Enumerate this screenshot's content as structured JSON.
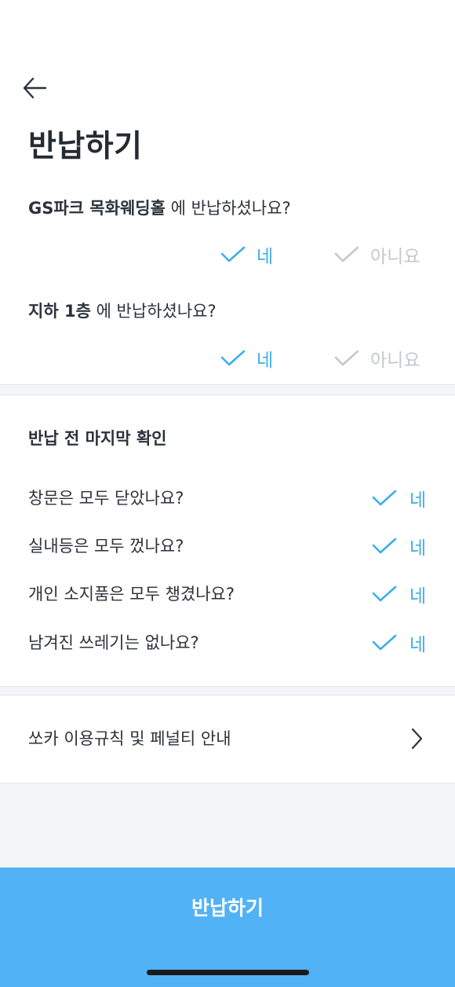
{
  "header": {
    "back_icon": "arrow-left-icon",
    "title": "반납하기"
  },
  "questions": [
    {
      "subject": "GS파크 목화웨딩홀",
      "suffix": " 에 반납하셨나요?",
      "yes_label": "네",
      "no_label": "아니요",
      "selected": "yes"
    },
    {
      "subject": "지하 1층",
      "suffix": " 에 반납하셨나요?",
      "yes_label": "네",
      "no_label": "아니요",
      "selected": "yes"
    }
  ],
  "checklist": {
    "title": "반납 전 마지막 확인",
    "items": [
      {
        "label": "창문은 모두 닫았나요?",
        "yes_label": "네"
      },
      {
        "label": "실내등은 모두 껐나요?",
        "yes_label": "네"
      },
      {
        "label": "개인 소지품은 모두 챙겼나요?",
        "yes_label": "네"
      },
      {
        "label": "남겨진 쓰레기는 없나요?",
        "yes_label": "네"
      }
    ]
  },
  "info_link": {
    "label": "쏘카 이용규칙 및 페널티 안내",
    "icon": "chevron-right-icon"
  },
  "submit": {
    "label": "반납하기"
  },
  "colors": {
    "accent": "#3eaee8",
    "muted": "#c4c8cd",
    "cta": "#51b2f5"
  }
}
